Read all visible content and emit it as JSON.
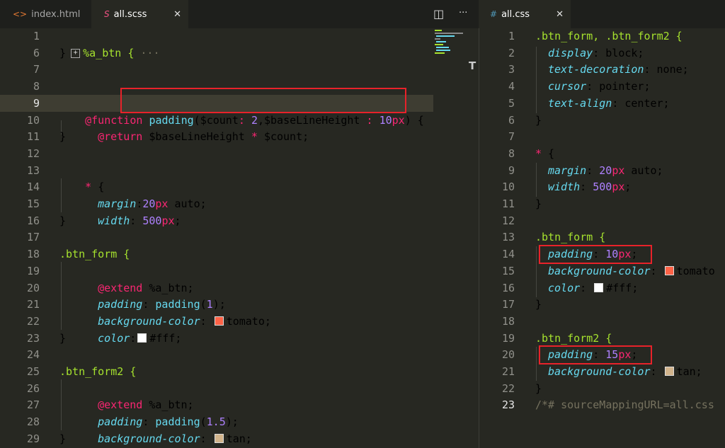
{
  "tabs_left": [
    {
      "label": "index.html",
      "icon": "<>"
    },
    {
      "label": "all.scss",
      "icon": "S"
    }
  ],
  "tabs_right": [
    {
      "label": "all.css",
      "icon": "#"
    }
  ],
  "close_glyph": "✕",
  "split_glyph": "◫",
  "more_glyph": "···",
  "left_numbers": [
    "1",
    "6",
    "7",
    "8",
    "9",
    "10",
    "11",
    "12",
    "13",
    "14",
    "15",
    "16",
    "17",
    "18",
    "19",
    "20",
    "21",
    "22",
    "23",
    "24",
    "25",
    "26",
    "27",
    "28",
    "29"
  ],
  "right_numbers": [
    "1",
    "2",
    "3",
    "4",
    "5",
    "6",
    "7",
    "8",
    "9",
    "10",
    "11",
    "12",
    "13",
    "14",
    "15",
    "16",
    "17",
    "18",
    "19",
    "20",
    "21",
    "22",
    "23"
  ],
  "left_text": {
    "l1_sel": "%a_btn {",
    "l1_more": "···",
    "close": "}",
    "fn_kw": "@function",
    "fn_name": "padding",
    "fn_p1": "(",
    "fn_var1": "$count",
    "fn_colon1": ":",
    "fn_num1": "2",
    "fn_comma": ",",
    "fn_var2": "$baseLineHeight",
    "fn_colon2": ":",
    "fn_num2": "10",
    "fn_unit2": "px",
    "fn_p2": ")",
    "fn_brace": " {",
    "ret_kw": "@return",
    "ret_var1": "$baseLineHeight",
    "ret_op": "*",
    "ret_var2": "$count;",
    "star": "*",
    "brace_open": "{",
    "margin_prop": "margin",
    "margin_colon": ":",
    "margin_num": "20",
    "margin_unit": "px",
    "margin_rest": " auto;",
    "width_prop": "width",
    "width_colon": ":",
    "width_num": "500",
    "width_unit": "px",
    "semi": ";",
    "btn_form": ".btn_form {",
    "extend_kw": "@extend",
    "extend_val": "%a_btn;",
    "pad_prop": "padding",
    "pad_fn": "padding",
    "pad_arg1": "1",
    "pad_arg2": "1.5",
    "bg_prop": "background-color",
    "bg_tomato": "tomato;",
    "bg_tan": "tan;",
    "color_prop": "color",
    "color_val": "#fff;",
    "btn_form2": ".btn_form2 {"
  },
  "right_text": {
    "sel1": ".btn_form, .btn_form2 {",
    "display_prop": "display",
    "display_val": " block;",
    "td_prop": "text-decoration",
    "td_val": " none;",
    "cursor_prop": "cursor",
    "cursor_val": " pointer;",
    "ta_prop": "text-align",
    "ta_val": " center;",
    "close": "}",
    "star": "*",
    "brace": " {",
    "margin_prop": "margin",
    "margin_num": "20",
    "margin_unit": "px",
    "margin_rest": " auto;",
    "width_prop": "width",
    "width_num": "500",
    "width_unit": "px",
    "semi": ";",
    "btn_form": ".btn_form {",
    "pad_prop": "padding",
    "pad1_num": "10",
    "pad_unit": "px",
    "bg_prop": "background-color",
    "tomato": "tomato",
    "tan": "tan;",
    "color_prop": "color",
    "color_val": "#fff;",
    "btn_form2": ".btn_form2 {",
    "pad2_num": "15",
    "comment": "/*# sourceMappingURL=all.css"
  },
  "colors": {
    "tomato": "#ff6347",
    "tan": "#d2b48c",
    "white": "#ffffff",
    "highlight_box": "#e8222a"
  }
}
